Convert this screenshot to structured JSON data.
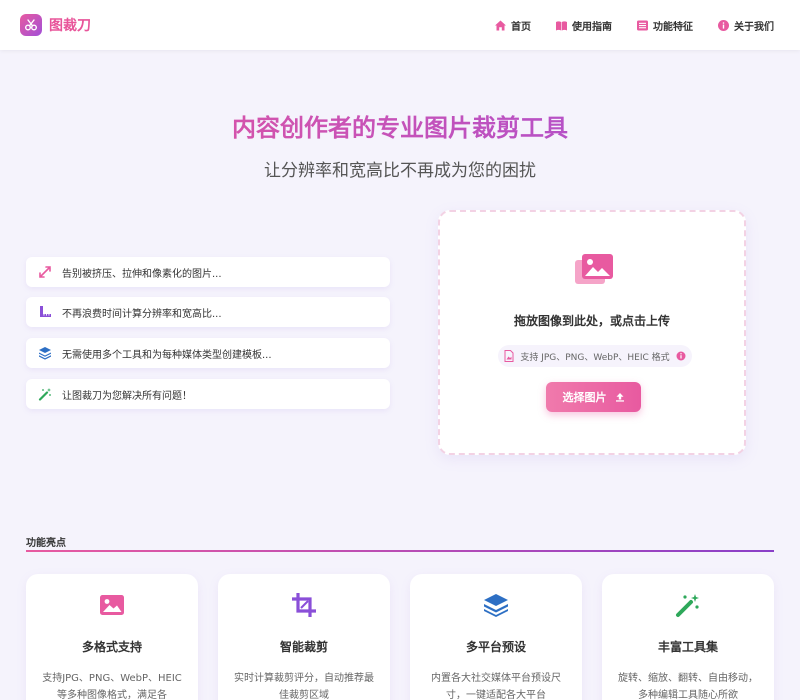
{
  "app": {
    "name": "图裁刀"
  },
  "nav": {
    "items": [
      {
        "label": "首页",
        "icon": "home-icon"
      },
      {
        "label": "使用指南",
        "icon": "book-icon"
      },
      {
        "label": "功能特征",
        "icon": "list-icon"
      },
      {
        "label": "关于我们",
        "icon": "info-icon"
      }
    ]
  },
  "hero": {
    "title": "内容创作者的专业图片裁剪工具",
    "subtitle": "让分辨率和宽高比不再成为您的困扰"
  },
  "pain_points": [
    {
      "text": "告别被挤压、拉伸和像素化的图片...",
      "icon": "expand-arrows-icon",
      "color": "#e85aa0"
    },
    {
      "text": "不再浪费时间计算分辨率和宽高比...",
      "icon": "ruler-icon",
      "color": "#8a4fd8"
    },
    {
      "text": "无需使用多个工具和为每种媒体类型创建模板...",
      "icon": "layers-icon",
      "color": "#2d6fc4"
    },
    {
      "text": "让图裁刀为您解决所有问题！",
      "icon": "magic-wand-icon",
      "color": "#2ea85a"
    }
  ],
  "upload": {
    "title": "拖放图像到此处，或点击上传",
    "formats": "支持 JPG、PNG、WebP、HEIC 格式",
    "button": "选择图片"
  },
  "features": {
    "section_title": "功能亮点",
    "cards": [
      {
        "title": "多格式支持",
        "desc": "支持JPG、PNG、WebP、HEIC等多种图像格式，满足各",
        "icon": "image-icon",
        "color": "#e85aa0"
      },
      {
        "title": "智能裁剪",
        "desc": "实时计算裁剪评分，自动推荐最佳裁剪区域",
        "icon": "crop-icon",
        "color": "#8a4fd8"
      },
      {
        "title": "多平台预设",
        "desc": "内置各大社交媒体平台预设尺寸，一键适配各大平台",
        "icon": "layers-icon",
        "color": "#2d6fc4"
      },
      {
        "title": "丰富工具集",
        "desc": "旋转、缩放、翻转、自由移动，多种编辑工具随心所欲",
        "icon": "magic-wand-icon",
        "color": "#2ea85a"
      }
    ]
  },
  "colors": {
    "accent_pink": "#e85aa0",
    "accent_purple": "#a24fd8",
    "background": "#f5f3fc"
  }
}
